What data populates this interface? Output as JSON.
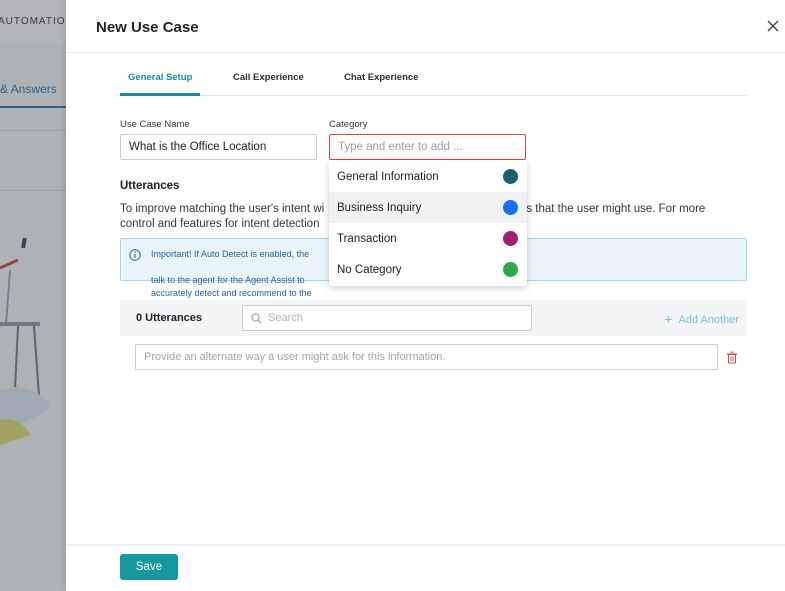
{
  "background": {
    "app_title": "AUTOMATIO",
    "nav_item": "& Answers"
  },
  "panel": {
    "title": "New Use Case",
    "close_icon": "close-icon"
  },
  "tabs": [
    {
      "label": "General Setup",
      "active": true
    },
    {
      "label": "Call Experience",
      "active": false
    },
    {
      "label": "Chat Experience",
      "active": false
    }
  ],
  "form": {
    "use_case_name_label": "Use Case Name",
    "use_case_name_value": "What is the Office Location",
    "category_label": "Category",
    "category_placeholder": "Type and enter to add ..."
  },
  "utterances": {
    "title": "Utterances",
    "description_line1": "To improve matching the user's intent wi",
    "description_line1_tail": "ces that the user might use. For more",
    "description_line2": "control and features for intent detection",
    "info_line1": "Important! If Auto Detect is enabled, the",
    "info_line1_tail": "talk to the agent for the Agent Assist to",
    "info_line2": "accurately detect and recommend to the",
    "count_label": "0 Utterances",
    "search_placeholder": "Search",
    "add_another_label": "Add Another",
    "alt_placeholder": "Provide an alternate way a user might ask for this information."
  },
  "dropdown": {
    "items": [
      {
        "label": "General Information",
        "color": "#1c5f6f"
      },
      {
        "label": "Business Inquiry",
        "color": "#1a6ef0"
      },
      {
        "label": "Transaction",
        "color": "#a31f74"
      },
      {
        "label": "No Category",
        "color": "#2ea94a"
      }
    ],
    "hovered_index": 1
  },
  "footer": {
    "save_label": "Save"
  },
  "colors": {
    "accent": "#1a8a99",
    "save_button": "#17979f",
    "error_border": "#d64545",
    "info_text": "#2563a8"
  }
}
